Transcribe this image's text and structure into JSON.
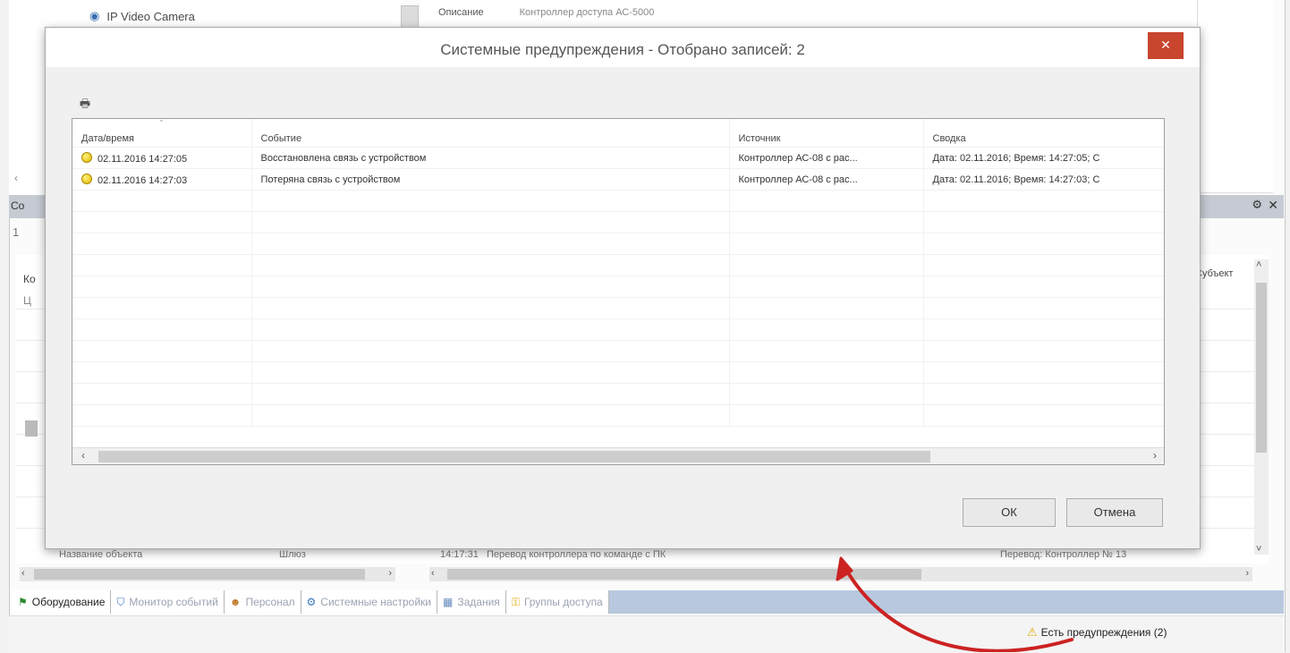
{
  "background": {
    "tree_item": "IP Video Camera",
    "prop_key": "Описание",
    "prop_value": "Контроллер доступа АС-5000",
    "panel_title_cut": "Со",
    "toolbar_cut": "1",
    "grid_col_cut": "Ко",
    "grid_cell_cut": "Ц",
    "subject_col": "Субъект",
    "bottom_row": {
      "col1": "Название объекта",
      "col2": "Шлюз",
      "time": "14:17:31",
      "event": "Перевод контроллера по команде с ПК",
      "summary": "Перевод: Контроллер № 13"
    }
  },
  "tabs": [
    {
      "label": "Оборудование",
      "icon": "flag-icon",
      "active": true
    },
    {
      "label": "Монитор событий",
      "icon": "shield-icon",
      "active": false
    },
    {
      "label": "Персонал",
      "icon": "people-icon",
      "active": false
    },
    {
      "label": "Системные настройки",
      "icon": "settings-icon",
      "active": false
    },
    {
      "label": "Задания",
      "icon": "calendar-icon",
      "active": false
    },
    {
      "label": "Группы доступа",
      "icon": "key-icon",
      "active": false
    }
  ],
  "status": {
    "warning_text": "Есть предупреждения (2)",
    "warning_icon": "warning-icon",
    "arrow_color": "#cc2222"
  },
  "dialog": {
    "title": "Системные предупреждения - Отобрано записей: 2",
    "close_glyph": "✕",
    "print_icon": "printer-icon",
    "columns": [
      "Дата/время",
      "Событие",
      "Источник",
      "Сводка"
    ],
    "rows": [
      {
        "datetime": "02.11.2016 14:27:05",
        "event": "Восстановлена связь с устройством",
        "source": "Контроллер АС-08 с рас...",
        "summary": "Дата: 02.11.2016; Время: 14:27:05; С"
      },
      {
        "datetime": "02.11.2016 14:27:03",
        "event": "Потеряна связь с устройством",
        "source": "Контроллер АС-08 с рас...",
        "summary": "Дата: 02.11.2016; Время: 14:27:03; С"
      }
    ],
    "ok_label": "ОК",
    "cancel_label": "Отмена"
  }
}
